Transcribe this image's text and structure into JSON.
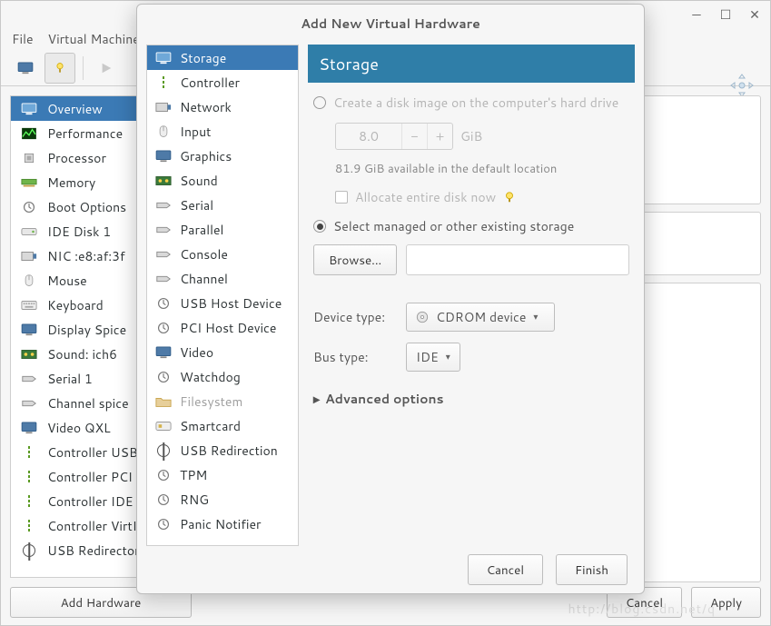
{
  "window": {
    "menus": [
      "File",
      "Virtual Machine"
    ],
    "buttons": {
      "add_hardware": "Add Hardware",
      "cancel": "Cancel",
      "apply": "Apply"
    }
  },
  "hardware_list": [
    {
      "label": "Overview",
      "icon": "monitor",
      "selected": true
    },
    {
      "label": "Performance",
      "icon": "perf"
    },
    {
      "label": "Processor",
      "icon": "cpu"
    },
    {
      "label": "Memory",
      "icon": "mem"
    },
    {
      "label": "Boot Options",
      "icon": "boot"
    },
    {
      "label": "IDE Disk 1",
      "icon": "disk"
    },
    {
      "label": "NIC :e8:af:3f",
      "icon": "nic"
    },
    {
      "label": "Mouse",
      "icon": "mouse"
    },
    {
      "label": "Keyboard",
      "icon": "keyboard"
    },
    {
      "label": "Display Spice",
      "icon": "display"
    },
    {
      "label": "Sound: ich6",
      "icon": "sound"
    },
    {
      "label": "Serial 1",
      "icon": "serial"
    },
    {
      "label": "Channel spice",
      "icon": "channel"
    },
    {
      "label": "Video QXL",
      "icon": "video"
    },
    {
      "label": "Controller USB",
      "icon": "controller"
    },
    {
      "label": "Controller PCI",
      "icon": "controller"
    },
    {
      "label": "Controller IDE",
      "icon": "controller"
    },
    {
      "label": "Controller VirtIO",
      "icon": "controller"
    },
    {
      "label": "USB Redirector",
      "icon": "usbredir"
    }
  ],
  "dialog": {
    "title": "Add New Virtual Hardware",
    "sidebar": [
      {
        "label": "Storage",
        "icon": "storage",
        "selected": true
      },
      {
        "label": "Controller",
        "icon": "controller"
      },
      {
        "label": "Network",
        "icon": "nic"
      },
      {
        "label": "Input",
        "icon": "mouse"
      },
      {
        "label": "Graphics",
        "icon": "display"
      },
      {
        "label": "Sound",
        "icon": "sound"
      },
      {
        "label": "Serial",
        "icon": "serial"
      },
      {
        "label": "Parallel",
        "icon": "serial"
      },
      {
        "label": "Console",
        "icon": "serial"
      },
      {
        "label": "Channel",
        "icon": "serial"
      },
      {
        "label": "USB Host Device",
        "icon": "usbhost"
      },
      {
        "label": "PCI Host Device",
        "icon": "usbhost"
      },
      {
        "label": "Video",
        "icon": "video"
      },
      {
        "label": "Watchdog",
        "icon": "watchdog"
      },
      {
        "label": "Filesystem",
        "icon": "folder",
        "disabled": true
      },
      {
        "label": "Smartcard",
        "icon": "smartcard"
      },
      {
        "label": "USB Redirection",
        "icon": "usbredir"
      },
      {
        "label": "TPM",
        "icon": "tpm"
      },
      {
        "label": "RNG",
        "icon": "rng"
      },
      {
        "label": "Panic Notifier",
        "icon": "panic"
      }
    ],
    "panel": {
      "title": "Storage",
      "radio_create": "Create a disk image on the computer's hard drive",
      "size_value": "8.0",
      "size_unit": "GiB",
      "available": "81.9 GiB available in the default location",
      "allocate": "Allocate entire disk now",
      "radio_managed": "Select managed or other existing storage",
      "browse": "Browse...",
      "device_type_label": "Device type:",
      "device_type_value": "CDROM device",
      "bus_type_label": "Bus type:",
      "bus_type_value": "IDE",
      "advanced": "Advanced options"
    },
    "buttons": {
      "cancel": "Cancel",
      "finish": "Finish"
    }
  }
}
